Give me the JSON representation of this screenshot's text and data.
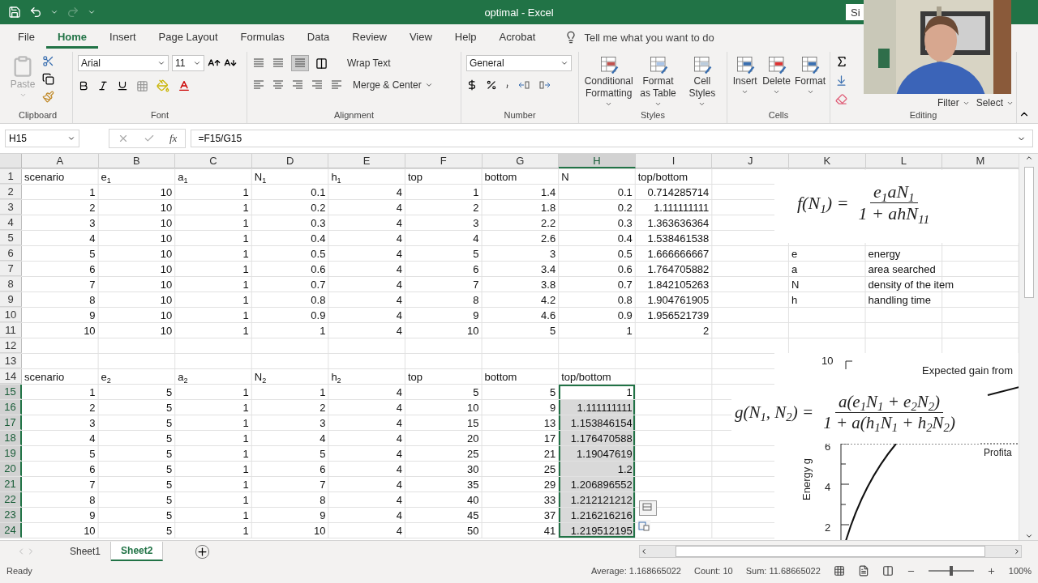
{
  "title_bar": {
    "title": "optimal  -  Excel",
    "sign_in": "Si"
  },
  "menu_tabs": [
    {
      "label": "File",
      "selected": false
    },
    {
      "label": "Home",
      "selected": true
    },
    {
      "label": "Insert",
      "selected": false
    },
    {
      "label": "Page Layout",
      "selected": false
    },
    {
      "label": "Formulas",
      "selected": false
    },
    {
      "label": "Data",
      "selected": false
    },
    {
      "label": "Review",
      "selected": false
    },
    {
      "label": "View",
      "selected": false
    },
    {
      "label": "Help",
      "selected": false
    },
    {
      "label": "Acrobat",
      "selected": false
    }
  ],
  "tell_me": {
    "placeholder": "Tell me what you want to do"
  },
  "ribbon": {
    "clipboard": {
      "paste": "Paste",
      "label": "Clipboard"
    },
    "font": {
      "font": "Arial",
      "size": "11",
      "label": "Font"
    },
    "alignment": {
      "wrap": "Wrap Text",
      "merge": "Merge & Center",
      "label": "Alignment"
    },
    "number": {
      "format": "General",
      "label": "Number"
    },
    "styles": {
      "buttons": [
        "Conditional Formatting",
        "Format as Table",
        "Cell Styles"
      ],
      "label": "Styles"
    },
    "cells": {
      "buttons": [
        "Insert",
        "Delete",
        "Format"
      ],
      "label": "Cells"
    },
    "editing": {
      "buttons": [
        "Filter",
        "Select"
      ],
      "label": "Editing"
    }
  },
  "formula_bar": {
    "name_box": "H15",
    "fx": "fx",
    "formula": "=F15/G15"
  },
  "columns": [
    {
      "label": "A",
      "selected": false
    },
    {
      "label": "B",
      "selected": false
    },
    {
      "label": "C",
      "selected": false
    },
    {
      "label": "D",
      "selected": false
    },
    {
      "label": "E",
      "selected": false
    },
    {
      "label": "F",
      "selected": false
    },
    {
      "label": "G",
      "selected": false
    },
    {
      "label": "H",
      "selected": true
    },
    {
      "label": "I",
      "selected": false
    },
    {
      "label": "J",
      "selected": false
    },
    {
      "label": "K",
      "selected": false
    },
    {
      "label": "L",
      "selected": false
    },
    {
      "label": "M",
      "selected": false
    }
  ],
  "rows": [
    {
      "n": "1",
      "kind": "header",
      "selected": false,
      "cells": {
        "A": "scenario",
        "B": "e$_{1}$",
        "C": "a$_{1}$",
        "D": "N$_{1}$",
        "E": "h$_{1}$",
        "F": "top",
        "G": "bottom",
        "H": "N",
        "I": "top/bottom"
      }
    },
    {
      "n": "2",
      "selected": false,
      "cells": {
        "A": "1",
        "B": "10",
        "C": "1",
        "D": "0.1",
        "E": "4",
        "F": "1",
        "G": "1.4",
        "H": "0.1",
        "I": "0.714285714"
      }
    },
    {
      "n": "3",
      "selected": false,
      "cells": {
        "A": "2",
        "B": "10",
        "C": "1",
        "D": "0.2",
        "E": "4",
        "F": "2",
        "G": "1.8",
        "H": "0.2",
        "I": "1.111111111"
      }
    },
    {
      "n": "4",
      "selected": false,
      "cells": {
        "A": "3",
        "B": "10",
        "C": "1",
        "D": "0.3",
        "E": "4",
        "F": "3",
        "G": "2.2",
        "H": "0.3",
        "I": "1.363636364"
      }
    },
    {
      "n": "5",
      "selected": false,
      "cells": {
        "A": "4",
        "B": "10",
        "C": "1",
        "D": "0.4",
        "E": "4",
        "F": "4",
        "G": "2.6",
        "H": "0.4",
        "I": "1.538461538"
      }
    },
    {
      "n": "6",
      "selected": false,
      "cells": {
        "A": "5",
        "B": "10",
        "C": "1",
        "D": "0.5",
        "E": "4",
        "F": "5",
        "G": "3",
        "H": "0.5",
        "I": "1.666666667"
      },
      "notes": {
        "K": "e",
        "L": "energy"
      }
    },
    {
      "n": "7",
      "selected": false,
      "cells": {
        "A": "6",
        "B": "10",
        "C": "1",
        "D": "0.6",
        "E": "4",
        "F": "6",
        "G": "3.4",
        "H": "0.6",
        "I": "1.764705882"
      },
      "notes": {
        "K": "a",
        "L": "area searched"
      }
    },
    {
      "n": "8",
      "selected": false,
      "cells": {
        "A": "7",
        "B": "10",
        "C": "1",
        "D": "0.7",
        "E": "4",
        "F": "7",
        "G": "3.8",
        "H": "0.7",
        "I": "1.842105263"
      },
      "notes": {
        "K": "N",
        "L": "density of the item"
      }
    },
    {
      "n": "9",
      "selected": false,
      "cells": {
        "A": "8",
        "B": "10",
        "C": "1",
        "D": "0.8",
        "E": "4",
        "F": "8",
        "G": "4.2",
        "H": "0.8",
        "I": "1.904761905"
      },
      "notes": {
        "K": "h",
        "L": "handling time"
      }
    },
    {
      "n": "10",
      "selected": false,
      "cells": {
        "A": "9",
        "B": "10",
        "C": "1",
        "D": "0.9",
        "E": "4",
        "F": "9",
        "G": "4.6",
        "H": "0.9",
        "I": "1.956521739"
      }
    },
    {
      "n": "11",
      "selected": false,
      "cells": {
        "A": "10",
        "B": "10",
        "C": "1",
        "D": "1",
        "E": "4",
        "F": "10",
        "G": "5",
        "H": "1",
        "I": "2"
      }
    },
    {
      "n": "12",
      "selected": false
    },
    {
      "n": "13",
      "selected": false
    },
    {
      "n": "14",
      "kind": "header",
      "selected": false,
      "cells": {
        "A": "scenario",
        "B": "e$_{2}$",
        "C": "a$_{2}$",
        "D": "N$_{2}$",
        "E": "h$_{2}$",
        "F": "top",
        "G": "bottom",
        "H": "top/bottom"
      }
    },
    {
      "n": "15",
      "selected": true,
      "cells": {
        "A": "1",
        "B": "5",
        "C": "1",
        "D": "1",
        "E": "4",
        "F": "5",
        "G": "5",
        "H": "1"
      }
    },
    {
      "n": "16",
      "selected": true,
      "cells": {
        "A": "2",
        "B": "5",
        "C": "1",
        "D": "2",
        "E": "4",
        "F": "10",
        "G": "9",
        "H": "1.111111111"
      }
    },
    {
      "n": "17",
      "selected": true,
      "cells": {
        "A": "3",
        "B": "5",
        "C": "1",
        "D": "3",
        "E": "4",
        "F": "15",
        "G": "13",
        "H": "1.153846154"
      }
    },
    {
      "n": "18",
      "selected": true,
      "cells": {
        "A": "4",
        "B": "5",
        "C": "1",
        "D": "4",
        "E": "4",
        "F": "20",
        "G": "17",
        "H": "1.176470588"
      }
    },
    {
      "n": "19",
      "selected": true,
      "cells": {
        "A": "5",
        "B": "5",
        "C": "1",
        "D": "5",
        "E": "4",
        "F": "25",
        "G": "21",
        "H": "1.19047619"
      }
    },
    {
      "n": "20",
      "selected": true,
      "cells": {
        "A": "6",
        "B": "5",
        "C": "1",
        "D": "6",
        "E": "4",
        "F": "30",
        "G": "25",
        "H": "1.2"
      }
    },
    {
      "n": "21",
      "selected": true,
      "cells": {
        "A": "7",
        "B": "5",
        "C": "1",
        "D": "7",
        "E": "4",
        "F": "35",
        "G": "29",
        "H": "1.206896552"
      }
    },
    {
      "n": "22",
      "selected": true,
      "cells": {
        "A": "8",
        "B": "5",
        "C": "1",
        "D": "8",
        "E": "4",
        "F": "40",
        "G": "33",
        "H": "1.212121212"
      }
    },
    {
      "n": "23",
      "selected": true,
      "cells": {
        "A": "9",
        "B": "5",
        "C": "1",
        "D": "9",
        "E": "4",
        "F": "45",
        "G": "37",
        "H": "1.216216216"
      }
    },
    {
      "n": "24",
      "selected": true,
      "cells": {
        "A": "10",
        "B": "5",
        "C": "1",
        "D": "10",
        "E": "4",
        "F": "50",
        "G": "41",
        "H": "1.219512195"
      }
    }
  ],
  "equation_f": {
    "lhs": "f(N$_{1}$) =",
    "numerator": "e$_{1}$aN$_{1}$",
    "denominator": "1 + ahN$_{11}$"
  },
  "equation_g": {
    "lhs": "g(N$_{1}$, N$_{2}$) =",
    "numerator": "a(e$_{1}$N$_{1}$ + e$_{2}$N$_{2}$)",
    "denominator": "1 + a(h$_{1}$N$_{1}$ + h$_{2}$N$_{2}$)"
  },
  "figure": {
    "top_tick": "10",
    "ticks": [
      "6",
      "4",
      "2"
    ],
    "ylabel": "Energy g",
    "annotations": [
      "Expected gain from",
      "Profita"
    ]
  },
  "sheet_tabs": [
    {
      "label": "Sheet1",
      "selected": false
    },
    {
      "label": "Sheet2",
      "selected": true
    }
  ],
  "status_bar": {
    "mode": "Ready",
    "average": "Average: 1.168665022",
    "count": "Count: 10",
    "sum": "Sum: 11.68665022",
    "zoom": "100%",
    "level": 0.5
  }
}
